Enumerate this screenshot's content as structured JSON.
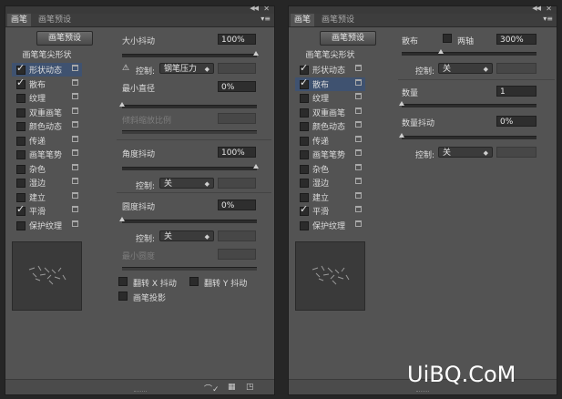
{
  "tabs": {
    "brush": "画笔",
    "presets": "画笔预设"
  },
  "preset_button": "画笔预设",
  "tip_shape_header": "画笔笔尖形状",
  "left_items": [
    {
      "label": "形状动态",
      "checked": true,
      "selected": true
    },
    {
      "label": "散布",
      "checked": true,
      "selected": false
    },
    {
      "label": "纹理",
      "checked": false,
      "selected": false
    },
    {
      "label": "双重画笔",
      "checked": false,
      "selected": false
    },
    {
      "label": "颜色动态",
      "checked": false,
      "selected": false
    },
    {
      "label": "传递",
      "checked": false,
      "selected": false
    },
    {
      "label": "画笔笔势",
      "checked": false,
      "selected": false
    },
    {
      "label": "杂色",
      "checked": false,
      "selected": false
    },
    {
      "label": "湿边",
      "checked": false,
      "selected": false
    },
    {
      "label": "建立",
      "checked": false,
      "selected": false
    },
    {
      "label": "平滑",
      "checked": true,
      "selected": false
    },
    {
      "label": "保护纹理",
      "checked": false,
      "selected": false
    }
  ],
  "right_items": [
    {
      "label": "形状动态",
      "checked": true,
      "selected": false
    },
    {
      "label": "散布",
      "checked": true,
      "selected": true
    },
    {
      "label": "纹理",
      "checked": false,
      "selected": false
    },
    {
      "label": "双重画笔",
      "checked": false,
      "selected": false
    },
    {
      "label": "颜色动态",
      "checked": false,
      "selected": false
    },
    {
      "label": "传递",
      "checked": false,
      "selected": false
    },
    {
      "label": "画笔笔势",
      "checked": false,
      "selected": false
    },
    {
      "label": "杂色",
      "checked": false,
      "selected": false
    },
    {
      "label": "湿边",
      "checked": false,
      "selected": false
    },
    {
      "label": "建立",
      "checked": false,
      "selected": false
    },
    {
      "label": "平滑",
      "checked": true,
      "selected": false
    },
    {
      "label": "保护纹理",
      "checked": false,
      "selected": false
    }
  ],
  "shape_dynamics": {
    "size_jitter_label": "大小抖动",
    "size_jitter_value": "100%",
    "control_label": "控制:",
    "size_control": "钢笔压力",
    "min_diameter_label": "最小直径",
    "min_diameter_value": "0%",
    "tilt_scale_label": "倾斜缩放比例",
    "angle_jitter_label": "角度抖动",
    "angle_jitter_value": "100%",
    "angle_control": "关",
    "roundness_jitter_label": "圆度抖动",
    "roundness_jitter_value": "0%",
    "roundness_control": "关",
    "min_roundness_label": "最小圆度",
    "flip_x_label": "翻转 X 抖动",
    "flip_y_label": "翻转 Y 抖动",
    "brush_projection_label": "画笔投影"
  },
  "scattering": {
    "scatter_label": "散布",
    "both_axes_label": "两轴",
    "scatter_value": "300%",
    "control_label": "控制:",
    "scatter_control": "关",
    "count_label": "数量",
    "count_value": "1",
    "count_jitter_label": "数量抖动",
    "count_jitter_value": "0%",
    "count_control": "关"
  },
  "watermark": "UiBQ.CoM"
}
